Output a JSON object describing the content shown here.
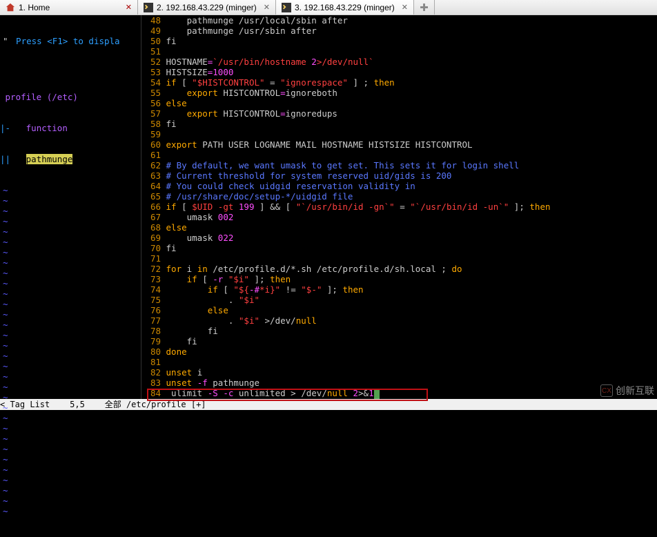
{
  "tabs": [
    {
      "label": "1. Home",
      "icon": "home-icon",
      "close": "red",
      "active": false
    },
    {
      "label": "2. 192.168.43.229 (minger)",
      "icon": "terminal-icon",
      "close": "gray",
      "active": false
    },
    {
      "label": "3. 192.168.43.229 (minger)",
      "icon": "terminal-icon",
      "close": "gray",
      "active": true
    }
  ],
  "left_pane": {
    "hint": " Press <F1> to displa",
    "outline_root": "profile (/etc)",
    "outline_func_label": "function",
    "outline_highlight": "pathmunge"
  },
  "code": {
    "lines": [
      {
        "n": "48",
        "segs": [
          [
            "    ",
            ""
          ],
          [
            "pathmunge /usr/local/sbin after",
            "txt"
          ]
        ]
      },
      {
        "n": "49",
        "segs": [
          [
            "    ",
            ""
          ],
          [
            "pathmunge /usr/sbin after",
            "txt"
          ]
        ]
      },
      {
        "n": "50",
        "segs": [
          [
            "fi",
            "txt"
          ]
        ]
      },
      {
        "n": "51",
        "segs": [
          [
            "",
            ""
          ]
        ]
      },
      {
        "n": "52",
        "segs": [
          [
            "HOSTNAME",
            "txt"
          ],
          [
            "=",
            "op"
          ],
          [
            "`/usr/bin/hostname ",
            "str-red"
          ],
          [
            "2",
            "num"
          ],
          [
            ">/dev/null`",
            "str-red"
          ]
        ]
      },
      {
        "n": "53",
        "segs": [
          [
            "HISTSIZE",
            "txt"
          ],
          [
            "=",
            "op"
          ],
          [
            "1000",
            "num"
          ]
        ]
      },
      {
        "n": "54",
        "segs": [
          [
            "if ",
            "kw-fn"
          ],
          [
            "[ ",
            "txt"
          ],
          [
            "\"$HISTCONTROL\"",
            "str-red"
          ],
          [
            " = ",
            "txt"
          ],
          [
            "\"ignorespace\"",
            "str-red"
          ],
          [
            " ] ; ",
            "txt"
          ],
          [
            "then",
            "kw-fn"
          ]
        ]
      },
      {
        "n": "55",
        "segs": [
          [
            "    ",
            ""
          ],
          [
            "export ",
            "kw-fn"
          ],
          [
            "HISTCONTROL",
            "txt"
          ],
          [
            "=",
            "op"
          ],
          [
            "ignoreboth",
            "txt"
          ]
        ]
      },
      {
        "n": "56",
        "segs": [
          [
            "else",
            "kw-fn"
          ]
        ]
      },
      {
        "n": "57",
        "segs": [
          [
            "    ",
            ""
          ],
          [
            "export ",
            "kw-fn"
          ],
          [
            "HISTCONTROL",
            "txt"
          ],
          [
            "=",
            "op"
          ],
          [
            "ignoredups",
            "txt"
          ]
        ]
      },
      {
        "n": "58",
        "segs": [
          [
            "fi",
            "txt"
          ]
        ]
      },
      {
        "n": "59",
        "segs": [
          [
            "",
            ""
          ]
        ]
      },
      {
        "n": "60",
        "segs": [
          [
            "export ",
            "kw-fn"
          ],
          [
            "PATH USER LOGNAME MAIL HOSTNAME HISTSIZE HISTCONTROL",
            "txt"
          ]
        ]
      },
      {
        "n": "61",
        "segs": [
          [
            "",
            ""
          ]
        ]
      },
      {
        "n": "62",
        "segs": [
          [
            "# By default, we want umask to get set. This sets it for login shell",
            "cmt"
          ]
        ]
      },
      {
        "n": "63",
        "segs": [
          [
            "# Current threshold for system reserved uid/gids is 200",
            "cmt"
          ]
        ]
      },
      {
        "n": "64",
        "segs": [
          [
            "# You could check uidgid reservation validity in",
            "cmt"
          ]
        ]
      },
      {
        "n": "65",
        "segs": [
          [
            "# /usr/share/doc/setup-*/uidgid file",
            "cmt"
          ]
        ]
      },
      {
        "n": "66",
        "segs": [
          [
            "if ",
            "kw-fn"
          ],
          [
            "[ ",
            "txt"
          ],
          [
            "$UID -gt ",
            "str-red"
          ],
          [
            "199 ",
            "num"
          ],
          [
            "] && [ ",
            "txt"
          ],
          [
            "\"`/usr/bin/id -gn`\"",
            "str-red"
          ],
          [
            " = ",
            "txt"
          ],
          [
            "\"`/usr/bin/id -un`\"",
            "str-red"
          ],
          [
            " ]; ",
            "txt"
          ],
          [
            "then",
            "kw-fn"
          ]
        ]
      },
      {
        "n": "67",
        "segs": [
          [
            "    umask ",
            "txt"
          ],
          [
            "002",
            "num"
          ]
        ]
      },
      {
        "n": "68",
        "segs": [
          [
            "else",
            "kw-fn"
          ]
        ]
      },
      {
        "n": "69",
        "segs": [
          [
            "    umask ",
            "txt"
          ],
          [
            "022",
            "num"
          ]
        ]
      },
      {
        "n": "70",
        "segs": [
          [
            "fi",
            "txt"
          ]
        ]
      },
      {
        "n": "71",
        "segs": [
          [
            "",
            ""
          ]
        ]
      },
      {
        "n": "72",
        "segs": [
          [
            "for ",
            "kw-fn"
          ],
          [
            "i ",
            "txt"
          ],
          [
            "in ",
            "kw-fn"
          ],
          [
            "/etc/profile.d/*.sh /etc/profile.d/sh.local ; ",
            "txt"
          ],
          [
            "do",
            "kw-fn"
          ]
        ]
      },
      {
        "n": "73",
        "segs": [
          [
            "    ",
            ""
          ],
          [
            "if ",
            "kw-fn"
          ],
          [
            "[ ",
            "txt"
          ],
          [
            "-r ",
            "op"
          ],
          [
            "\"$i\"",
            "str-red"
          ],
          [
            " ]; ",
            "txt"
          ],
          [
            "then",
            "kw-fn"
          ]
        ]
      },
      {
        "n": "74",
        "segs": [
          [
            "        ",
            ""
          ],
          [
            "if ",
            "kw-fn"
          ],
          [
            "[ ",
            "txt"
          ],
          [
            "\"${",
            "str-red"
          ],
          [
            "-#",
            "op"
          ],
          [
            "*i",
            "str-red"
          ],
          [
            "}\"",
            "str-red"
          ],
          [
            " != ",
            "txt"
          ],
          [
            "\"$-\"",
            "str-red"
          ],
          [
            " ]; ",
            "txt"
          ],
          [
            "then",
            "kw-fn"
          ]
        ]
      },
      {
        "n": "75",
        "segs": [
          [
            "            . ",
            "txt"
          ],
          [
            "\"$i\"",
            "str-red"
          ]
        ]
      },
      {
        "n": "76",
        "segs": [
          [
            "        ",
            ""
          ],
          [
            "else",
            "kw-fn"
          ]
        ]
      },
      {
        "n": "77",
        "segs": [
          [
            "            . ",
            "txt"
          ],
          [
            "\"$i\"",
            "str-red"
          ],
          [
            " >/dev/",
            "txt"
          ],
          [
            "null",
            "kw-fn"
          ]
        ]
      },
      {
        "n": "78",
        "segs": [
          [
            "        ",
            ""
          ],
          [
            "fi",
            "txt"
          ]
        ]
      },
      {
        "n": "79",
        "segs": [
          [
            "    ",
            ""
          ],
          [
            "fi",
            "txt"
          ]
        ]
      },
      {
        "n": "80",
        "segs": [
          [
            "done",
            "kw-fn"
          ]
        ]
      },
      {
        "n": "81",
        "segs": [
          [
            "",
            ""
          ]
        ]
      },
      {
        "n": "82",
        "segs": [
          [
            "unset ",
            "kw-fn"
          ],
          [
            "i",
            "txt"
          ]
        ]
      },
      {
        "n": "83",
        "segs": [
          [
            "unset ",
            "kw-fn"
          ],
          [
            "-f ",
            "op"
          ],
          [
            "pathmunge",
            "txt"
          ]
        ]
      },
      {
        "n": "84",
        "segs": [
          [
            " ulimit ",
            "txt"
          ],
          [
            "-S -c ",
            "op"
          ],
          [
            "unlimited > /dev/",
            "txt"
          ],
          [
            "null ",
            "kw-fn"
          ],
          [
            "2",
            "num"
          ],
          [
            ">&",
            "txt"
          ],
          [
            "1",
            "num"
          ]
        ],
        "cursor": true
      }
    ]
  },
  "status_bar": "< Tag List    5,5    全部 /etc/profile [+]",
  "watermark": {
    "logo": "CX",
    "text": "创新互联"
  }
}
